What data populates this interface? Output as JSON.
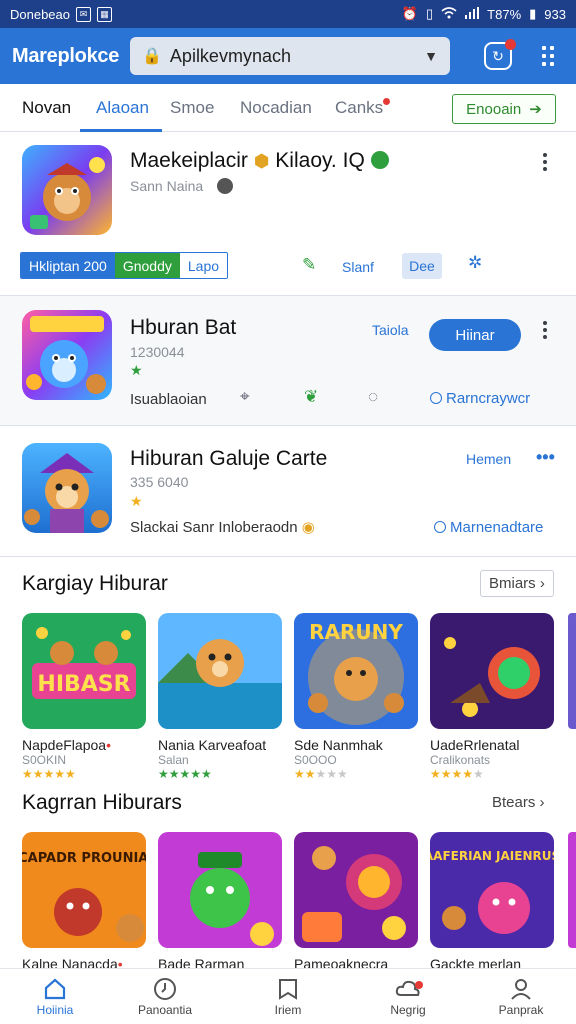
{
  "status_bar": {
    "left_text": "Donebeao",
    "battery": "T87%",
    "time": "933"
  },
  "app_bar": {
    "brand": "Mareplokce",
    "search_value": "Apilkevmynach"
  },
  "tabs": [
    {
      "label": "Novan"
    },
    {
      "label": "Alaoan"
    },
    {
      "label": "Smoe"
    },
    {
      "label": "Nocadian"
    },
    {
      "label": "Canks"
    }
  ],
  "tab_action": {
    "label": "Enooain"
  },
  "featured": {
    "title": "Maekeiplacir",
    "title_tail": "Kilaoy. IQ",
    "subtitle": "Sann Naina",
    "chips": [
      "Hkliptan 200",
      "Gnoddy",
      "Lapo"
    ],
    "action_label": "Slanf",
    "toggle_label": "Dee"
  },
  "item2": {
    "title": "Hburan Bat",
    "meta": "1230044",
    "link_label": "Taiola",
    "button_label": "Hiinar",
    "foot_label": "Isuablaoian",
    "foot_link": "Rarncraywcr"
  },
  "item3": {
    "title": "Hiburan Galuje Carte",
    "meta": "335 6040",
    "link_label": "Hemen",
    "foot_label": "Slackai Sanr Inloberaodn",
    "foot_link": "Marnenadtare"
  },
  "section1": {
    "title": "Kargiay Hiburar",
    "more": "Bmiars",
    "tiles": [
      {
        "art": "HIBASR",
        "name": "NapdeFlapoa",
        "meta": "S0OKIN",
        "rating": 5,
        "star_color": "gold"
      },
      {
        "art": "",
        "name": "Nania Karveafoat",
        "meta": "Salan",
        "rating": 5,
        "star_color": "green"
      },
      {
        "art": "RARUNY",
        "name": "Sde Nanmhak",
        "meta": "S0OOO",
        "rating": 2,
        "star_color": "gold"
      },
      {
        "art": "",
        "name": "UadeRrlenatal",
        "meta": "Cralikonats",
        "rating": 4,
        "star_color": "gold"
      }
    ]
  },
  "section2": {
    "title": "Kagrran Hiburars",
    "more": "Btears",
    "tiles": [
      {
        "art": "SCAPADR PROUNIAN",
        "name": "Kalne Nanacda"
      },
      {
        "art": "",
        "name": "Bade Rarman"
      },
      {
        "art": "",
        "name": "Pameoaknecra"
      },
      {
        "art": "AAFERIAN JAIENRUS",
        "name": "Gackte merlan"
      }
    ]
  },
  "bottom_nav": [
    {
      "label": "Hoiinia",
      "icon": "home-icon"
    },
    {
      "label": "Panoantia",
      "icon": "clock-icon"
    },
    {
      "label": "Iriem",
      "icon": "book-icon"
    },
    {
      "label": "Negrig",
      "icon": "cloud-icon"
    },
    {
      "label": "Panprak",
      "icon": "person-icon"
    }
  ],
  "colors": {
    "primary": "#2a74d6",
    "status_bar": "#1e3f8a",
    "green": "#2f9e3c",
    "badge_red": "#e53935"
  }
}
